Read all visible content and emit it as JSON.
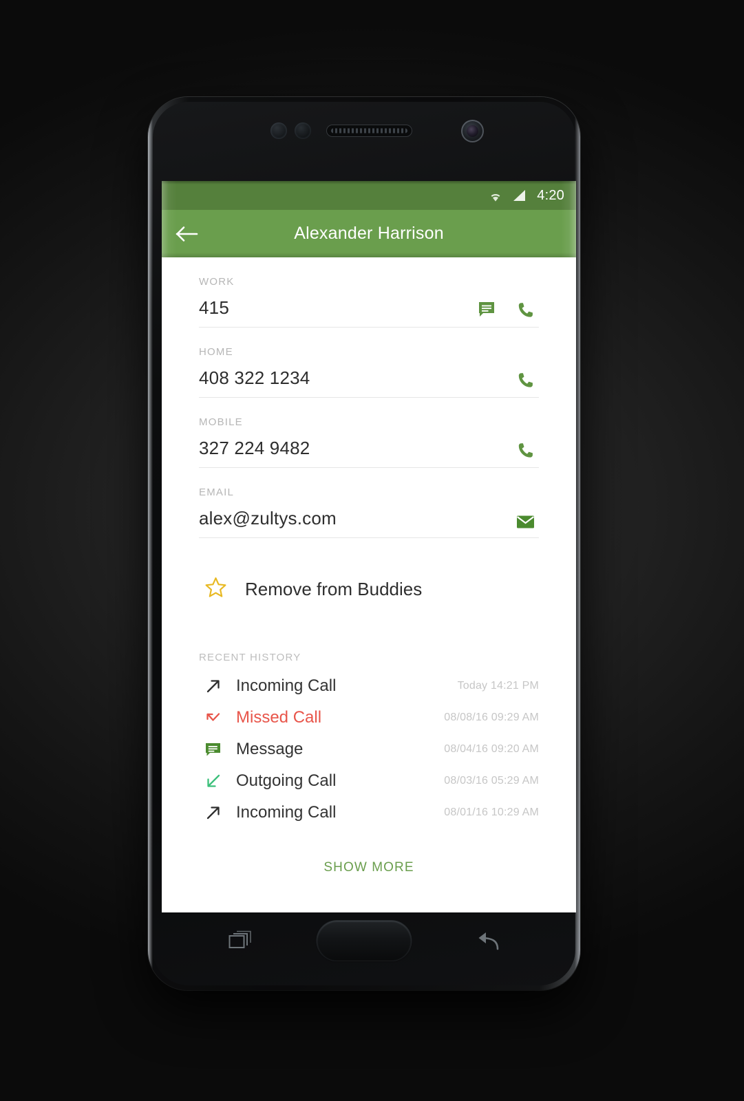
{
  "status_bar": {
    "time": "4:20",
    "wifi_icon": "wifi-icon",
    "signal_icon": "signal-icon"
  },
  "app_bar": {
    "back_icon": "back-arrow-icon",
    "title": "Alexander Harrison"
  },
  "colors": {
    "app_bar_green": "#6a9e4d",
    "status_bar_green": "#55803c",
    "missed_red": "#e8554a",
    "star_gold": "#e8b923",
    "outgoing_green": "#3bbf7a"
  },
  "fields": [
    {
      "label": "WORK",
      "value": "415",
      "actions": [
        "message-icon",
        "call-icon"
      ]
    },
    {
      "label": "HOME",
      "value": "408 322 1234",
      "actions": [
        "call-icon"
      ]
    },
    {
      "label": "MOBILE",
      "value": "327 224 9482",
      "actions": [
        "call-icon"
      ]
    },
    {
      "label": "EMAIL",
      "value": "alex@zultys.com",
      "actions": [
        "email-icon"
      ]
    }
  ],
  "buddies": {
    "icon": "star-outline-icon",
    "label": "Remove from Buddies"
  },
  "history": {
    "header": "RECENT HISTORY",
    "rows": [
      {
        "icon": "incoming-call-icon",
        "label": "Incoming Call",
        "time": "Today 14:21 PM",
        "type": "incoming"
      },
      {
        "icon": "missed-call-icon",
        "label": "Missed Call",
        "time": "08/08/16 09:29 AM",
        "type": "missed"
      },
      {
        "icon": "message-icon",
        "label": "Message",
        "time": "08/04/16 09:20 AM",
        "type": "message"
      },
      {
        "icon": "outgoing-call-icon",
        "label": "Outgoing Call",
        "time": "08/03/16 05:29 AM",
        "type": "outgoing"
      },
      {
        "icon": "incoming-call-icon",
        "label": "Incoming Call",
        "time": "08/01/16 10:29 AM",
        "type": "incoming"
      }
    ],
    "show_more": "SHOW MORE"
  },
  "device": {
    "recents_icon": "recents-icon",
    "home_button": "home-button",
    "back_icon": "back-nav-icon",
    "front_camera": "front-camera-icon",
    "earpiece": "earpiece-speaker",
    "sensors": [
      "proximity-sensor-icon",
      "light-sensor-icon"
    ]
  }
}
